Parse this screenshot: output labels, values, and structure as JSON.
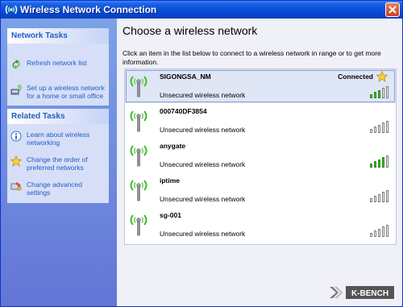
{
  "window": {
    "title": "Wireless Network Connection"
  },
  "network_tasks": {
    "header": "Network Tasks",
    "items": [
      {
        "label": "Refresh network list",
        "icon": "refresh-icon"
      },
      {
        "label": "Set up a wireless network for a home or small office",
        "icon": "setup-network-icon"
      }
    ]
  },
  "related_tasks": {
    "header": "Related Tasks",
    "items": [
      {
        "label": "Learn about wireless networking",
        "icon": "info-icon"
      },
      {
        "label": "Change the order of preferred networks",
        "icon": "star-icon"
      },
      {
        "label": "Change advanced settings",
        "icon": "settings-icon"
      }
    ]
  },
  "main": {
    "title": "Choose a wireless network",
    "description": "Click an item in the list below to connect to a wireless network in range or to get more information."
  },
  "networks": [
    {
      "ssid": "SIGONGSA_NM",
      "security": "Unsecured wireless network",
      "status": "Connected",
      "signal": 3,
      "selected": true
    },
    {
      "ssid": "000740DF3854",
      "security": "Unsecured wireless network",
      "status": "",
      "signal": 0,
      "selected": false
    },
    {
      "ssid": "anygate",
      "security": "Unsecured wireless network",
      "status": "",
      "signal": 4,
      "selected": false
    },
    {
      "ssid": "iptime",
      "security": "Unsecured wireless network",
      "status": "",
      "signal": 0,
      "selected": false
    },
    {
      "ssid": "sg-001",
      "security": "Unsecured wireless network",
      "status": "",
      "signal": 0,
      "selected": false
    }
  ],
  "signal_max": 5,
  "colors": {
    "title_bar": "#0a52dd",
    "task_link": "#215dc6",
    "signal_on": "#3fbe2a",
    "left_pane": "#6f8ddd"
  }
}
